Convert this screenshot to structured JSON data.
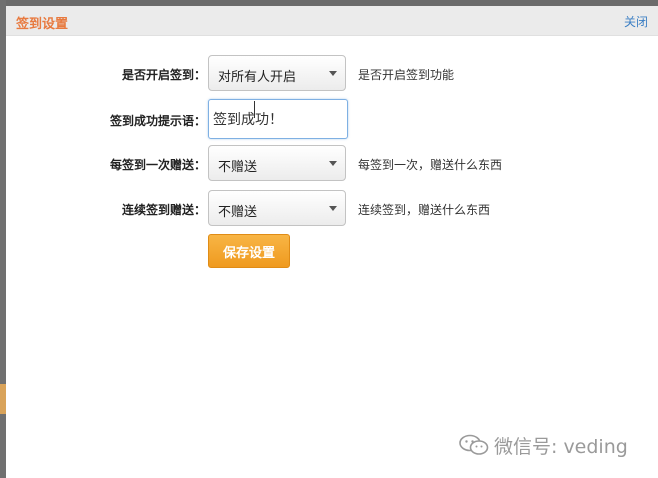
{
  "dialog": {
    "title": "签到设置",
    "close_label": "关闭"
  },
  "form": {
    "enable": {
      "label": "是否开启签到：",
      "value": "对所有人开启",
      "hint": "是否开启签到功能"
    },
    "success_message": {
      "label": "签到成功提示语：",
      "value": "签到成功！"
    },
    "per_checkin_gift": {
      "label": "每签到一次赠送：",
      "value": "不赠送",
      "hint": "每签到一次，赠送什么东西"
    },
    "streak_gift": {
      "label": "连续签到赠送：",
      "value": "不赠送",
      "hint": "连续签到，赠送什么东西"
    },
    "save_label": "保存设置"
  },
  "watermark": {
    "text": "微信号: veding",
    "icon": "wechat-icon"
  },
  "colors": {
    "title": "#e87a3f",
    "link": "#3c7fc4",
    "button": "#f0a02a"
  }
}
